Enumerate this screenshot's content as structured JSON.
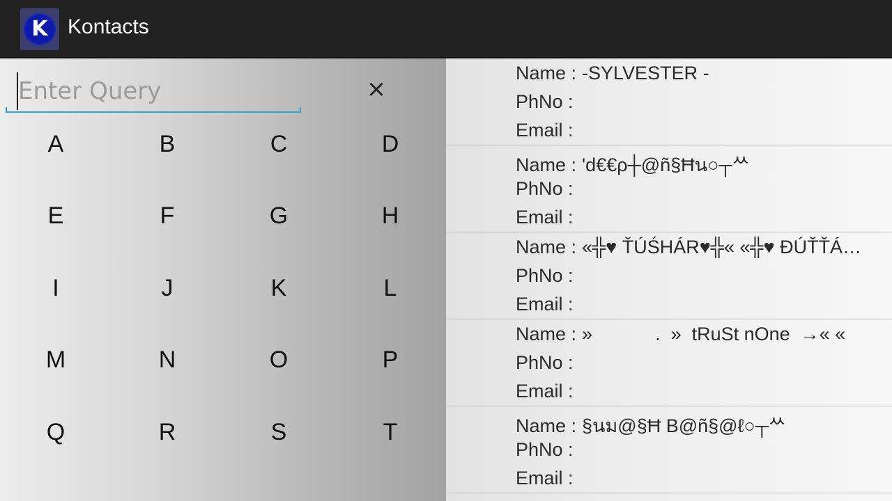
{
  "app": {
    "title": "Kontacts",
    "icon_letter": "K"
  },
  "search": {
    "placeholder": "Enter Query",
    "value": "",
    "clear_glyph": "×"
  },
  "keypad": {
    "rows": [
      [
        "A",
        "B",
        "C",
        "D"
      ],
      [
        "E",
        "F",
        "G",
        "H"
      ],
      [
        "I",
        "J",
        "K",
        "L"
      ],
      [
        "M",
        "N",
        "O",
        "P"
      ],
      [
        "Q",
        "R",
        "S",
        "T"
      ]
    ]
  },
  "labels": {
    "name": "Name :",
    "phone": "PhNo :",
    "email": "Email :"
  },
  "contacts": [
    {
      "name": "-SYLVESTER -",
      "phone": "",
      "email": ""
    },
    {
      "name": "'d€€ρ┼@ñ§Ħน○┬ᄊ",
      "phone": "",
      "email": ""
    },
    {
      "name": "«╬♥ ŤÚŚHÁR♥╬« «╬♥ ĐÚŤŤÁ…",
      "phone": "",
      "email": ""
    },
    {
      "name": "»            .  »  tRuSt nOne  →« «",
      "phone": "",
      "email": ""
    },
    {
      "name": "§นม@§Ħ B@ñ§@ℓ○┬ᄊ",
      "phone": "",
      "email": ""
    }
  ]
}
